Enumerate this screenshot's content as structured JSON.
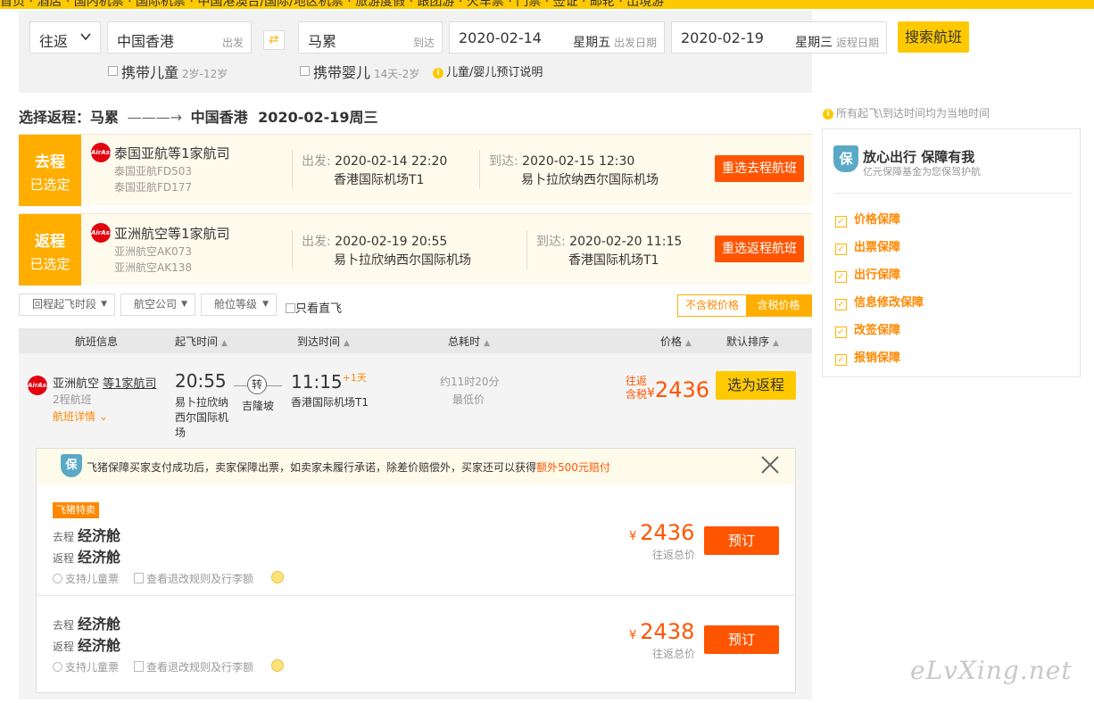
{
  "topnav": "首页 · 酒店 · 国内机票 · 国际机票 · 中国港澳台/国际/地区机票 · 旅游度假 · 跟团游 · 火车票 · 门票 · 签证 · 邮轮 · 出境游",
  "search": {
    "trip_type": "往返",
    "from_city": "中国香港",
    "from_label": "出发",
    "to_city": "马累",
    "to_label": "到达",
    "depart_date": "2020-02-14",
    "depart_weekday": "星期五",
    "depart_label": "出发日期",
    "return_date": "2020-02-19",
    "return_weekday": "星期三",
    "return_label": "返程日期",
    "search_button": "搜索航班",
    "child_label": "携带儿童",
    "child_age": "2岁-12岁",
    "infant_label": "携带婴儿",
    "infant_age": "14天-2岁",
    "booking_info": "儿童/婴儿预订说明"
  },
  "route_title": {
    "prefix": "选择返程：马累",
    "arrow": "———→",
    "dest": "中国香港",
    "date": "2020-02-19周三"
  },
  "outbound": {
    "tag1": "去程",
    "tag2": "已选定",
    "airline": "泰国亚航等1家航司",
    "flight1": "泰国亚航FD503",
    "flight2": "泰国亚航FD177",
    "dep_label": "出发:",
    "dep_time": "2020-02-14 22:20",
    "dep_airport": "香港国际机场T1",
    "arr_label": "到达:",
    "arr_time": "2020-02-15 12:30",
    "arr_airport": "易卜拉欣纳西尔国际机场",
    "reselect": "重选去程航班"
  },
  "inbound": {
    "tag1": "返程",
    "tag2": "已选定",
    "airline": "亚洲航空等1家航司",
    "flight1": "亚洲航空AK073",
    "flight2": "亚洲航空AK138",
    "dep_label": "出发:",
    "dep_time": "2020-02-19 20:55",
    "dep_airport": "易卜拉欣纳西尔国际机场",
    "arr_label": "到达:",
    "arr_time": "2020-02-20 11:15",
    "arr_airport": "香港国际机场T1",
    "reselect": "重选返程航班"
  },
  "filters": {
    "time": "回程起飞时段",
    "airline": "航空公司",
    "cabin": "舱位等级",
    "direct": "只看直飞",
    "tax_excl": "不含税价格",
    "tax_incl": "含税价格"
  },
  "columns": {
    "info": "航班信息",
    "dep": "起飞时间",
    "arr": "到达时间",
    "dur": "总耗时",
    "price": "价格",
    "sort": "默认排序"
  },
  "flight": {
    "airline": "亚洲航空",
    "more": "等1家航司",
    "sub": "2程航班",
    "detail": "航班详情",
    "dep_time": "20:55",
    "dep_airport": "易卜拉欣纳西尔国际机场",
    "stop": "转",
    "stop_city": "吉隆坡",
    "arr_time": "11:15",
    "arr_plus": "+1天",
    "arr_airport": "香港国际机场T1",
    "duration": "约11时20分",
    "cheapest": "最低价",
    "price_label1": "往返",
    "price_label2": "含税",
    "price": "2436",
    "select": "选为返程"
  },
  "guarantee": {
    "text": "飞猪保障买家支付成功后，卖家保障出票，如卖家未履行承诺，除差价赔偿外，买家还可以获得",
    "highlight": "额外500元赔付"
  },
  "offers": [
    {
      "tag": "飞猪特卖",
      "out_label": "去程",
      "out_cabin": "经济舱",
      "ret_label": "返程",
      "ret_cabin": "经济舱",
      "child": "支持儿童票",
      "rules": "查看退改规则及行李额",
      "price": "2436",
      "price_sub": "往返总价",
      "book": "预订"
    },
    {
      "out_label": "去程",
      "out_cabin": "经济舱",
      "ret_label": "返程",
      "ret_cabin": "经济舱",
      "child": "支持儿童票",
      "rules": "查看退改规则及行李额",
      "price": "2438",
      "price_sub": "往返总价",
      "book": "预订"
    }
  ],
  "side": {
    "note": "所有起飞\\到达时间均为当地时间",
    "title": "放心出行 保障有我",
    "subtitle": "亿元保障基金为您保驾护航",
    "items": [
      "价格保障",
      "出票保障",
      "出行保障",
      "信息修改保障",
      "改签保障",
      "报销保障"
    ]
  },
  "logo_text": "AirAsia",
  "yen": "¥",
  "watermark": "eLvXing.net"
}
